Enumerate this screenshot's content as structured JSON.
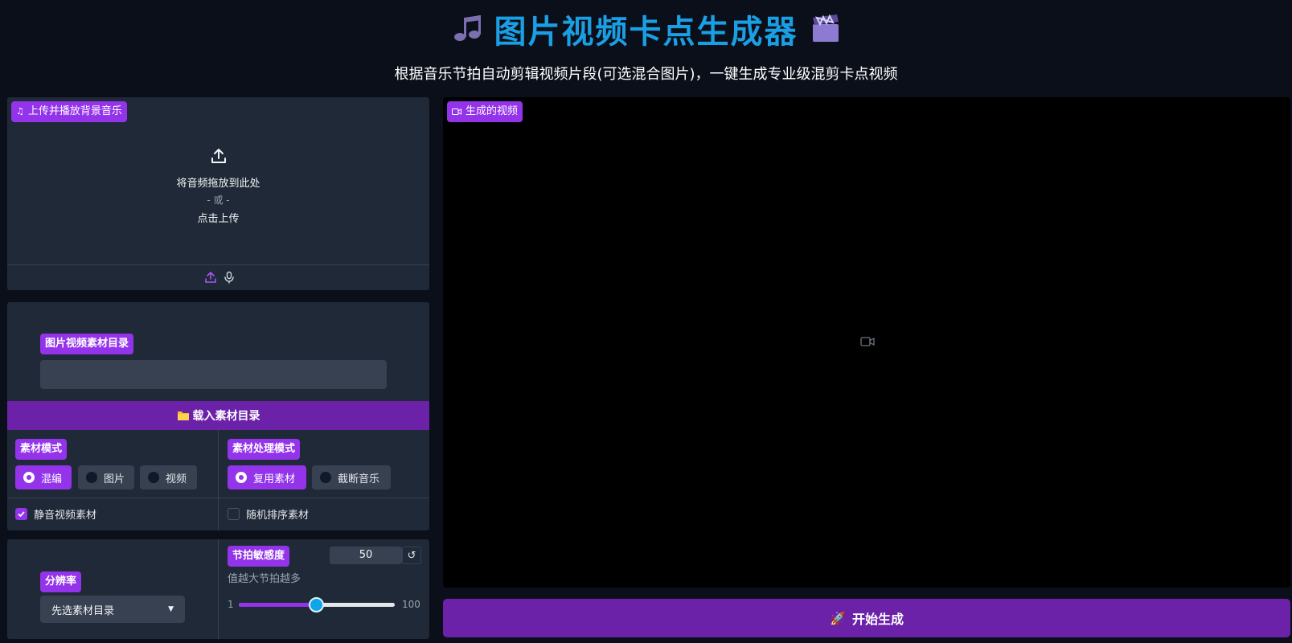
{
  "header": {
    "title": "图片视频卡点生成器",
    "subtitle": "根据音乐节拍自动剪辑视频片段(可选混合图片)，一键生成专业级混剪卡点视频",
    "left_icon": "music-notes-emoji",
    "right_icon": "clapper-board-emoji"
  },
  "audio": {
    "label": "上传并播放背景音乐",
    "drop_text": "将音频拖放到此处",
    "or_text": "- 或 -",
    "click_text": "点击上传"
  },
  "source": {
    "dir_label": "图片视频素材目录",
    "dir_value": "",
    "load_button": "载入素材目录"
  },
  "mode": {
    "label": "素材模式",
    "options": [
      "混编",
      "图片",
      "视频"
    ],
    "selected": "混编"
  },
  "process_mode": {
    "label": "素材处理模式",
    "options": [
      "复用素材",
      "截断音乐"
    ],
    "selected": "复用素材"
  },
  "checks": {
    "mute_label": "静音视频素材",
    "mute_checked": true,
    "shuffle_label": "随机排序素材",
    "shuffle_checked": false
  },
  "resolution": {
    "label": "分辨率",
    "value": "先选素材目录"
  },
  "beat": {
    "label": "节拍敏感度",
    "info": "值越大节拍越多",
    "value": "50",
    "min_label": "1",
    "max_label": "100",
    "min": 1,
    "max": 100,
    "current": 50
  },
  "output": {
    "label": "生成的视频"
  },
  "generate_button": "开始生成",
  "colors": {
    "accent": "#9333ea",
    "button": "#6b21a8",
    "title": "#1a9fe4",
    "bg": "#0b0f19",
    "panel": "#1f2937"
  }
}
